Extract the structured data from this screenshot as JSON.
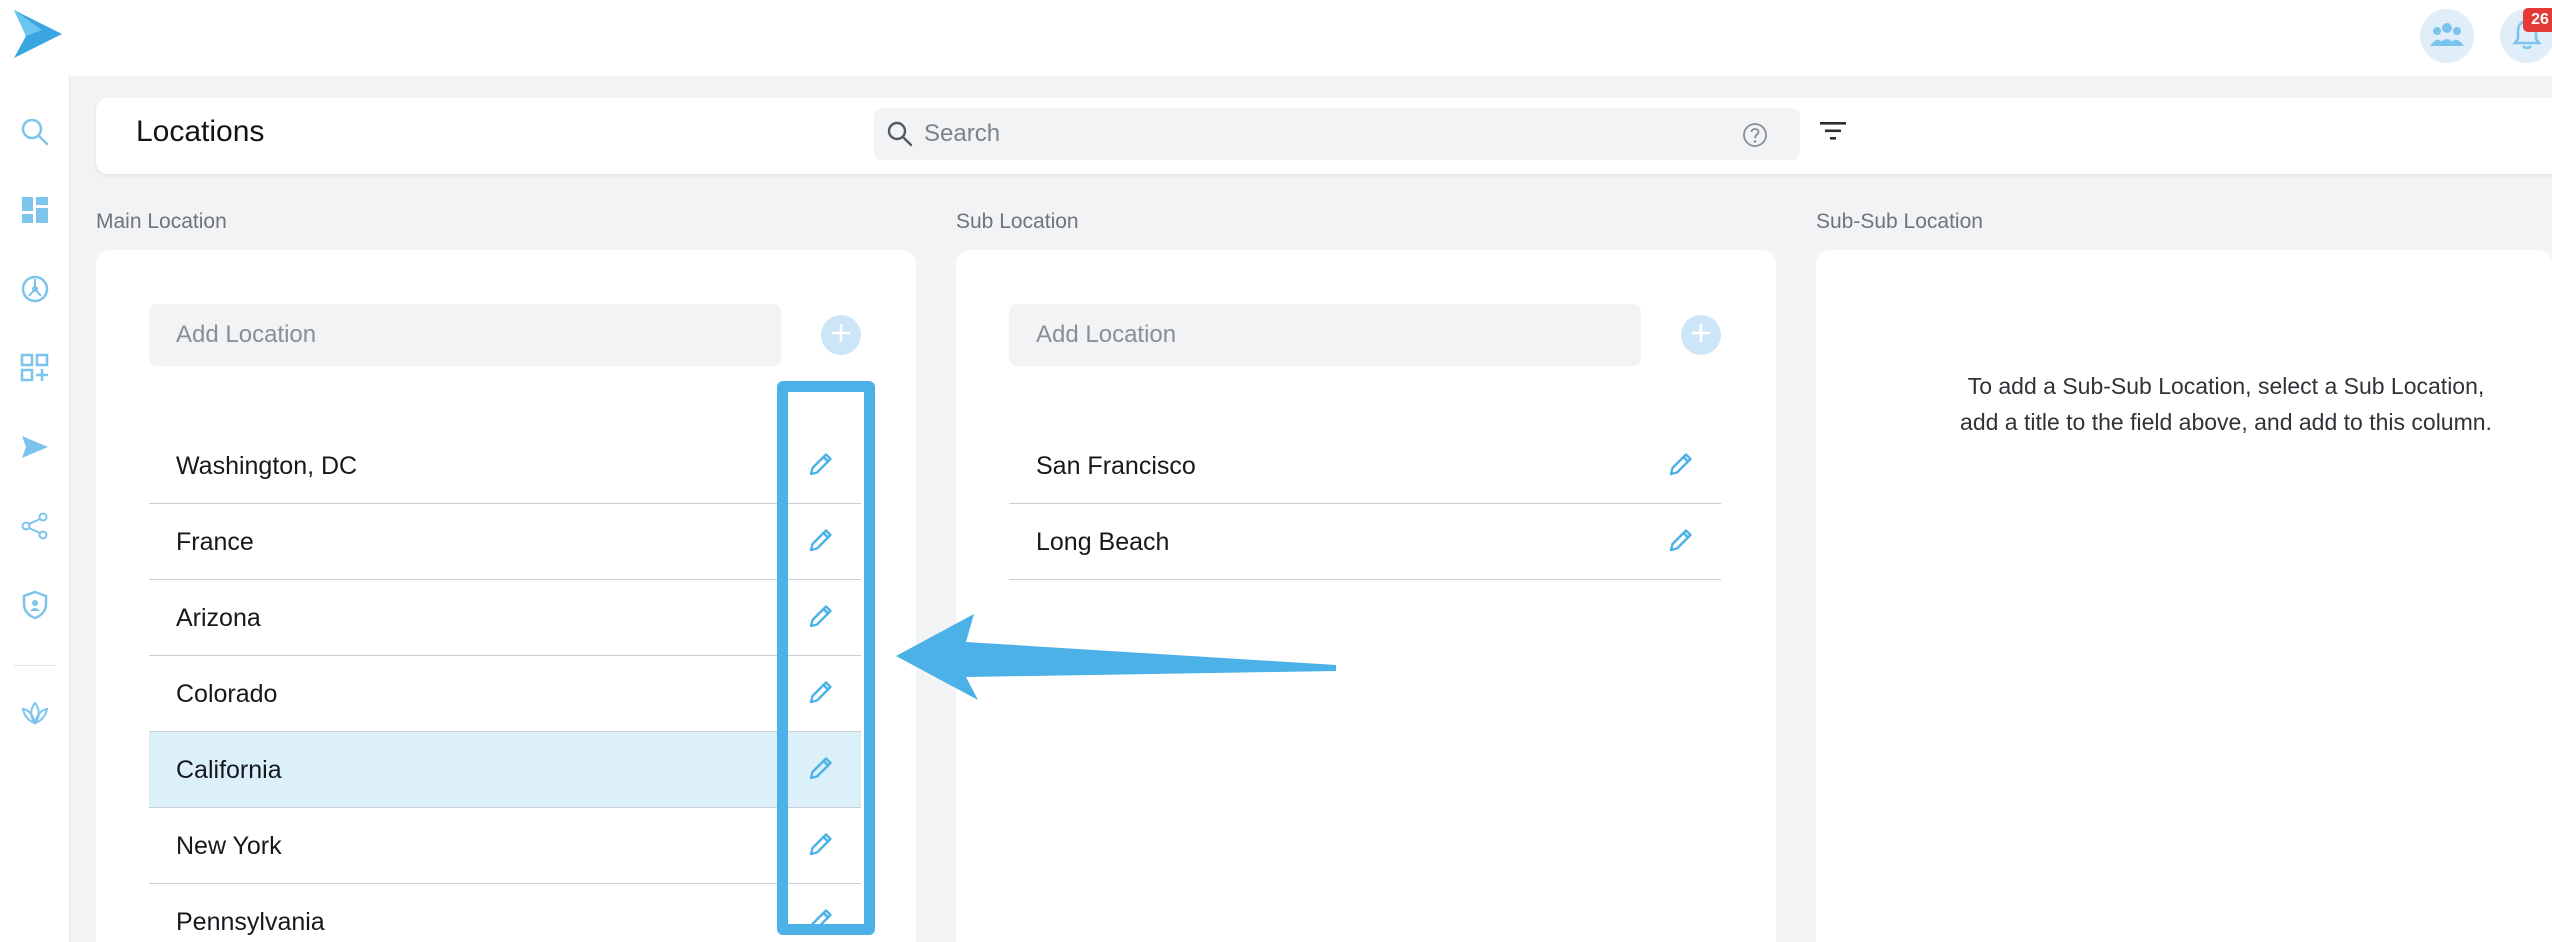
{
  "topbar": {
    "notifications_count": "26"
  },
  "header": {
    "title": "Locations",
    "search_placeholder": "Search"
  },
  "columns": {
    "main": {
      "label": "Main Location",
      "add_placeholder": "Add Location",
      "items": [
        "Washington, DC",
        "France",
        "Arizona",
        "Colorado",
        "California",
        "New York",
        "Pennsylvania"
      ],
      "selected_item": "California"
    },
    "sub": {
      "label": "Sub Location",
      "add_placeholder": "Add Location",
      "items": [
        "San Francisco",
        "Long Beach"
      ]
    },
    "subsub": {
      "label": "Sub-Sub Location",
      "empty_message": "To add a Sub-Sub Location, select a Sub Location, add a title to the field above, and add to this column."
    }
  },
  "icons": {
    "brand": "paper-plane-logo",
    "team": "people-group-icon",
    "notifications": "bell-icon",
    "sidebar": [
      "search-icon",
      "dashboard-icon",
      "compass-icon",
      "add-widget-icon",
      "send-icon",
      "share-icon",
      "shield-icon",
      "lotus-icon"
    ],
    "edit": "pencil-icon",
    "add": "plus-icon",
    "filter": "filter-icon",
    "help": "help-circle-icon"
  },
  "colors": {
    "accent": "#4cb1e6",
    "selected_row": "#dcf0fa",
    "badge": "#e53935"
  }
}
